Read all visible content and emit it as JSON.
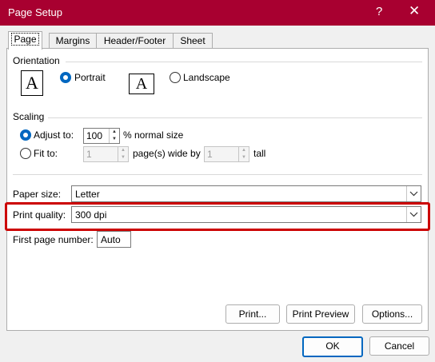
{
  "dialog": {
    "title": "Page Setup",
    "help_glyph": "?",
    "close_glyph": "✕"
  },
  "tabs": [
    {
      "label": "Page",
      "active": true
    },
    {
      "label": "Margins",
      "active": false
    },
    {
      "label": "Header/Footer",
      "active": false
    },
    {
      "label": "Sheet",
      "active": false
    }
  ],
  "orientation": {
    "heading": "Orientation",
    "portrait_label": "Portrait",
    "landscape_label": "Landscape",
    "selected": "portrait",
    "icon_glyph": "A"
  },
  "scaling": {
    "heading": "Scaling",
    "adjust_to_label": "Adjust to:",
    "adjust_to_value": "100",
    "normal_size_label": "% normal size",
    "fit_to_label": "Fit to:",
    "pages_wide_value": "1",
    "pages_wide_label": "page(s) wide by",
    "pages_tall_value": "1",
    "tall_label": "tall",
    "selected": "adjust"
  },
  "paper_size": {
    "label": "Paper size:",
    "value": "Letter"
  },
  "print_quality": {
    "label": "Print quality:",
    "value": "300 dpi"
  },
  "first_page_number": {
    "label": "First page number:",
    "value": "Auto"
  },
  "buttons": {
    "print": "Print...",
    "print_preview": "Print Preview",
    "options": "Options...",
    "ok": "OK",
    "cancel": "Cancel"
  },
  "colors": {
    "titlebar": "#a80030",
    "accent": "#0067c0",
    "highlight": "#cc0000"
  }
}
